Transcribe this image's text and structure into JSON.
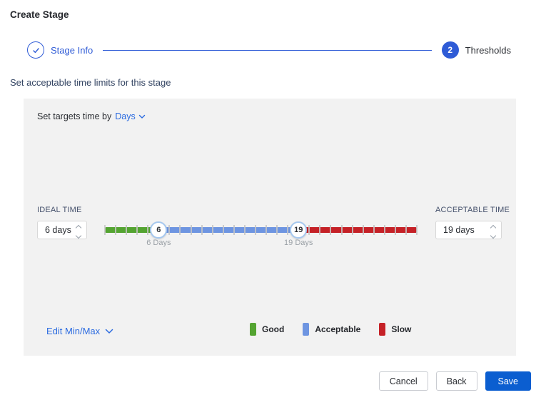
{
  "title": "Create Stage",
  "stepper": {
    "step1": {
      "label": "Stage Info",
      "state": "complete"
    },
    "step2": {
      "label": "Thresholds",
      "number": "2",
      "state": "active"
    }
  },
  "subtitle": "Set acceptable time limits for this stage",
  "panel": {
    "targets_prefix": "Set targets time by",
    "targets_value": "Days",
    "ideal": {
      "label": "IDEAL TIME",
      "value": "6 days"
    },
    "acceptable": {
      "label": "ACCEPTABLE TIME",
      "value": "19 days"
    },
    "edit_minmax_label": "Edit Min/Max",
    "legend": [
      {
        "label": "Good",
        "color": "#54a431"
      },
      {
        "label": "Acceptable",
        "color": "#6e95e1"
      },
      {
        "label": "Slow",
        "color": "#c52127"
      }
    ]
  },
  "slider": {
    "min": 1,
    "max": 30,
    "ideal_value": 6,
    "acceptable_value": 19,
    "ideal_handle": "6",
    "acceptable_handle": "19",
    "ideal_caption": "6 Days",
    "acceptable_caption": "19 Days",
    "colors": {
      "good": "#54a431",
      "acceptable": "#6e95e1",
      "slow": "#c52127"
    }
  },
  "footer": {
    "cancel": "Cancel",
    "back": "Back",
    "save": "Save"
  },
  "colors": {
    "accent_blue": "#2e5bd6",
    "link_blue": "#2b6be0",
    "save_blue": "#0b5ed0",
    "panel_bg": "#f2f2f2",
    "handle_border": "#a6c8ef",
    "tick": "#c6c6c6"
  }
}
